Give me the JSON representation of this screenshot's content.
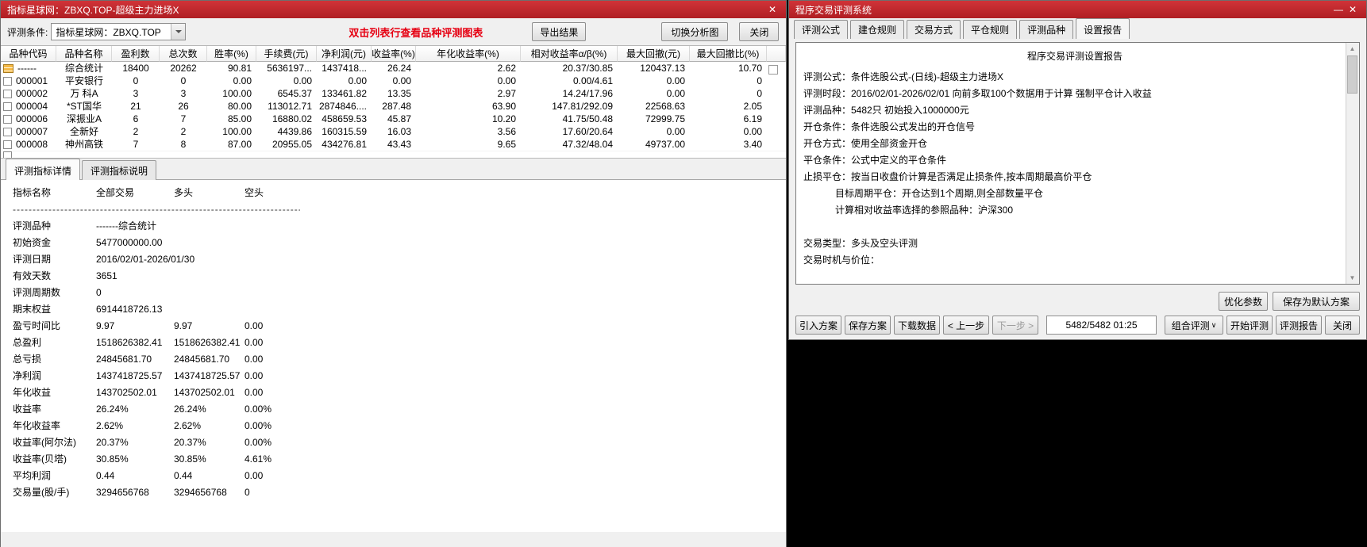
{
  "left_window": {
    "title": "指标星球网：ZBXQ.TOP-超级主力进场X",
    "close_glyph": "✕",
    "toolbar": {
      "condition_label": "评测条件:",
      "condition_value": "指标星球网：ZBXQ.TOP",
      "hint": "双击列表行查看品种评测图表",
      "export_button": "导出结果",
      "switch_button": "切换分析图",
      "close_button": "关闭"
    },
    "table": {
      "columns": [
        "品种代码",
        "品种名称",
        "盈利数",
        "总次数",
        "胜率(%)",
        "手续费(元)",
        "净利润(元)",
        "收益率(%)",
        "年化收益率(%)",
        "相对收益率α/β(%)",
        "最大回撤(元)",
        "最大回撤比(%)"
      ],
      "rows": [
        {
          "code": "------",
          "name": "综合统计",
          "win_count": "18400",
          "total": "20262",
          "win_rate": "90.81",
          "fee": "5636197...",
          "net_profit": "1437418...",
          "ret": "26.24",
          "annual_ret": "2.62",
          "relative": "20.37/30.85",
          "drawdown": "120437.13",
          "drawdown_pct": "10.70"
        },
        {
          "code": "000001",
          "name": "平安银行",
          "win_count": "0",
          "total": "0",
          "win_rate": "0.00",
          "fee": "0.00",
          "net_profit": "0.00",
          "ret": "0.00",
          "annual_ret": "0.00",
          "relative": "0.00/4.61",
          "drawdown": "0.00",
          "drawdown_pct": "0"
        },
        {
          "code": "000002",
          "name": "万 科A",
          "win_count": "3",
          "total": "3",
          "win_rate": "100.00",
          "fee": "6545.37",
          "net_profit": "133461.82",
          "ret": "13.35",
          "annual_ret": "2.97",
          "relative": "14.24/17.96",
          "drawdown": "0.00",
          "drawdown_pct": "0"
        },
        {
          "code": "000004",
          "name": "*ST国华",
          "win_count": "21",
          "total": "26",
          "win_rate": "80.00",
          "fee": "113012.71",
          "net_profit": "2874846....",
          "ret": "287.48",
          "annual_ret": "63.90",
          "relative": "147.81/292.09",
          "drawdown": "22568.63",
          "drawdown_pct": "2.05"
        },
        {
          "code": "000006",
          "name": "深振业A",
          "win_count": "6",
          "total": "7",
          "win_rate": "85.00",
          "fee": "16880.02",
          "net_profit": "458659.53",
          "ret": "45.87",
          "annual_ret": "10.20",
          "relative": "41.75/50.48",
          "drawdown": "72999.75",
          "drawdown_pct": "6.19"
        },
        {
          "code": "000007",
          "name": "全新好",
          "win_count": "2",
          "total": "2",
          "win_rate": "100.00",
          "fee": "4439.86",
          "net_profit": "160315.59",
          "ret": "16.03",
          "annual_ret": "3.56",
          "relative": "17.60/20.64",
          "drawdown": "0.00",
          "drawdown_pct": "0.00"
        },
        {
          "code": "000008",
          "name": "神州高铁",
          "win_count": "7",
          "total": "8",
          "win_rate": "87.00",
          "fee": "20955.05",
          "net_profit": "434276.81",
          "ret": "43.43",
          "annual_ret": "9.65",
          "relative": "47.32/48.04",
          "drawdown": "49737.00",
          "drawdown_pct": "3.40"
        }
      ]
    },
    "detail_tabs": {
      "details_label": "评测指标详情",
      "notes_label": "评测指标说明"
    },
    "details": {
      "headers": [
        "指标名称",
        "全部交易",
        "多头",
        "空头"
      ],
      "separator": "--------------------------------------------------------------------------------------------------------------",
      "rows": [
        {
          "name": "评测品种",
          "all": "-------综合统计",
          "long": "",
          "short": ""
        },
        {
          "name": "初始资金",
          "all": "5477000000.00",
          "long": "",
          "short": ""
        },
        {
          "name": "评测日期",
          "all": "2016/02/01-2026/01/30",
          "long": "",
          "short": ""
        },
        {
          "name": "有效天数",
          "all": "3651",
          "long": "",
          "short": ""
        },
        {
          "name": "评测周期数",
          "all": "0",
          "long": "",
          "short": ""
        },
        {
          "name": "期末权益",
          "all": "6914418726.13",
          "long": "",
          "short": ""
        },
        {
          "name": "盈亏时间比",
          "all": "9.97",
          "long": "9.97",
          "short": "0.00"
        },
        {
          "name": "总盈利",
          "all": "1518626382.41",
          "long": "1518626382.41",
          "short": "0.00"
        },
        {
          "name": "总亏损",
          "all": "24845681.70",
          "long": "24845681.70",
          "short": "0.00"
        },
        {
          "name": "净利润",
          "all": "1437418725.57",
          "long": "1437418725.57",
          "short": "0.00"
        },
        {
          "name": "年化收益",
          "all": "143702502.01",
          "long": "143702502.01",
          "short": "0.00"
        },
        {
          "name": "收益率",
          "all": "26.24%",
          "long": "26.24%",
          "short": "0.00%"
        },
        {
          "name": "年化收益率",
          "all": "2.62%",
          "long": "2.62%",
          "short": "0.00%"
        },
        {
          "name": "收益率(阿尔法)",
          "all": "20.37%",
          "long": "20.37%",
          "short": "0.00%"
        },
        {
          "name": "收益率(贝塔)",
          "all": "30.85%",
          "long": "30.85%",
          "short": "4.61%"
        },
        {
          "name": "平均利润",
          "all": "0.44",
          "long": "0.44",
          "short": "0.00"
        },
        {
          "name": "交易量(股/手)",
          "all": "3294656768",
          "long": "3294656768",
          "short": "0"
        }
      ]
    }
  },
  "right_window": {
    "title": "程序交易评测系统",
    "minimize_glyph": "—",
    "close_glyph": "✕",
    "tabs": [
      {
        "label": "评测公式"
      },
      {
        "label": "建仓规则"
      },
      {
        "label": "交易方式"
      },
      {
        "label": "平仓规则"
      },
      {
        "label": "评测品种"
      },
      {
        "label": "设置报告"
      }
    ],
    "report": {
      "title": "程序交易评测设置报告",
      "lines": [
        "评测公式：条件选股公式-(日线)-超级主力进场X",
        "评测时段：2016/02/01-2026/02/01 向前多取100个数据用于计算 强制平仓计入收益",
        "评测品种：5482只 初始投入1000000元",
        "开仓条件：条件选股公式发出的开仓信号",
        "开仓方式：使用全部资金开仓",
        "平仓条件：公式中定义的平仓条件",
        "止损平仓：按当日收盘价计算是否满足止损条件,按本周期最高价平仓",
        "            目标周期平仓：开仓达到1个周期,则全部数量平仓",
        "            计算相对收益率选择的参照品种：沪深300",
        "",
        "交易类型：多头及空头评测",
        "交易时机与价位："
      ]
    },
    "panel_buttons": {
      "optimize": "优化参数",
      "save_default": "保存为默认方案"
    },
    "bottom_bar": {
      "import_plan": "引入方案",
      "save_plan": "保存方案",
      "download_data": "下载数据",
      "prev_step": "< 上一步",
      "next_step": "下一步 >",
      "progress": "5482/5482 01:25",
      "combo_eval": "组合评测",
      "combo_eval_arrow": "∨",
      "start_eval": "开始评测",
      "eval_report": "评测报告",
      "close": "关闭"
    }
  }
}
